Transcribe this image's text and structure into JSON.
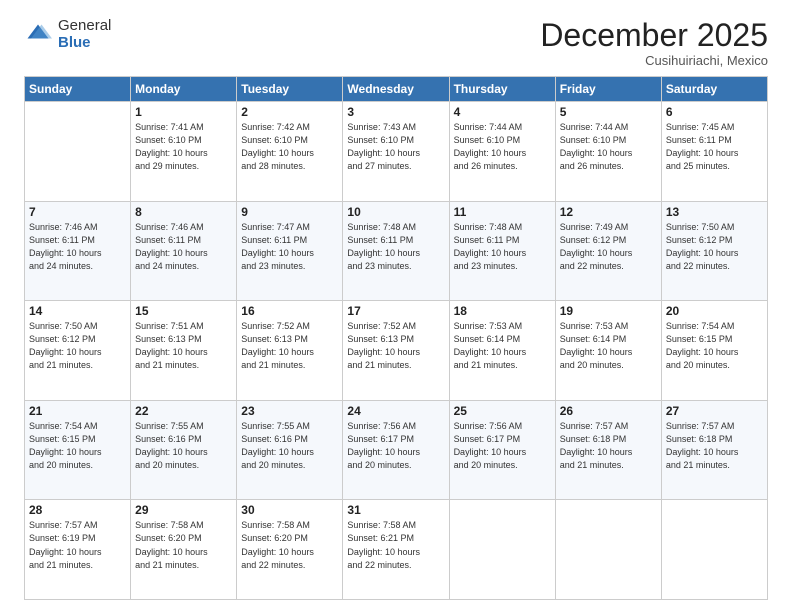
{
  "logo": {
    "general": "General",
    "blue": "Blue"
  },
  "header": {
    "month": "December 2025",
    "location": "Cusihuiriachi, Mexico"
  },
  "weekdays": [
    "Sunday",
    "Monday",
    "Tuesday",
    "Wednesday",
    "Thursday",
    "Friday",
    "Saturday"
  ],
  "weeks": [
    [
      {
        "day": "",
        "info": ""
      },
      {
        "day": "1",
        "info": "Sunrise: 7:41 AM\nSunset: 6:10 PM\nDaylight: 10 hours\nand 29 minutes."
      },
      {
        "day": "2",
        "info": "Sunrise: 7:42 AM\nSunset: 6:10 PM\nDaylight: 10 hours\nand 28 minutes."
      },
      {
        "day": "3",
        "info": "Sunrise: 7:43 AM\nSunset: 6:10 PM\nDaylight: 10 hours\nand 27 minutes."
      },
      {
        "day": "4",
        "info": "Sunrise: 7:44 AM\nSunset: 6:10 PM\nDaylight: 10 hours\nand 26 minutes."
      },
      {
        "day": "5",
        "info": "Sunrise: 7:44 AM\nSunset: 6:10 PM\nDaylight: 10 hours\nand 26 minutes."
      },
      {
        "day": "6",
        "info": "Sunrise: 7:45 AM\nSunset: 6:11 PM\nDaylight: 10 hours\nand 25 minutes."
      }
    ],
    [
      {
        "day": "7",
        "info": "Sunrise: 7:46 AM\nSunset: 6:11 PM\nDaylight: 10 hours\nand 24 minutes."
      },
      {
        "day": "8",
        "info": "Sunrise: 7:46 AM\nSunset: 6:11 PM\nDaylight: 10 hours\nand 24 minutes."
      },
      {
        "day": "9",
        "info": "Sunrise: 7:47 AM\nSunset: 6:11 PM\nDaylight: 10 hours\nand 23 minutes."
      },
      {
        "day": "10",
        "info": "Sunrise: 7:48 AM\nSunset: 6:11 PM\nDaylight: 10 hours\nand 23 minutes."
      },
      {
        "day": "11",
        "info": "Sunrise: 7:48 AM\nSunset: 6:11 PM\nDaylight: 10 hours\nand 23 minutes."
      },
      {
        "day": "12",
        "info": "Sunrise: 7:49 AM\nSunset: 6:12 PM\nDaylight: 10 hours\nand 22 minutes."
      },
      {
        "day": "13",
        "info": "Sunrise: 7:50 AM\nSunset: 6:12 PM\nDaylight: 10 hours\nand 22 minutes."
      }
    ],
    [
      {
        "day": "14",
        "info": "Sunrise: 7:50 AM\nSunset: 6:12 PM\nDaylight: 10 hours\nand 21 minutes."
      },
      {
        "day": "15",
        "info": "Sunrise: 7:51 AM\nSunset: 6:13 PM\nDaylight: 10 hours\nand 21 minutes."
      },
      {
        "day": "16",
        "info": "Sunrise: 7:52 AM\nSunset: 6:13 PM\nDaylight: 10 hours\nand 21 minutes."
      },
      {
        "day": "17",
        "info": "Sunrise: 7:52 AM\nSunset: 6:13 PM\nDaylight: 10 hours\nand 21 minutes."
      },
      {
        "day": "18",
        "info": "Sunrise: 7:53 AM\nSunset: 6:14 PM\nDaylight: 10 hours\nand 21 minutes."
      },
      {
        "day": "19",
        "info": "Sunrise: 7:53 AM\nSunset: 6:14 PM\nDaylight: 10 hours\nand 20 minutes."
      },
      {
        "day": "20",
        "info": "Sunrise: 7:54 AM\nSunset: 6:15 PM\nDaylight: 10 hours\nand 20 minutes."
      }
    ],
    [
      {
        "day": "21",
        "info": "Sunrise: 7:54 AM\nSunset: 6:15 PM\nDaylight: 10 hours\nand 20 minutes."
      },
      {
        "day": "22",
        "info": "Sunrise: 7:55 AM\nSunset: 6:16 PM\nDaylight: 10 hours\nand 20 minutes."
      },
      {
        "day": "23",
        "info": "Sunrise: 7:55 AM\nSunset: 6:16 PM\nDaylight: 10 hours\nand 20 minutes."
      },
      {
        "day": "24",
        "info": "Sunrise: 7:56 AM\nSunset: 6:17 PM\nDaylight: 10 hours\nand 20 minutes."
      },
      {
        "day": "25",
        "info": "Sunrise: 7:56 AM\nSunset: 6:17 PM\nDaylight: 10 hours\nand 20 minutes."
      },
      {
        "day": "26",
        "info": "Sunrise: 7:57 AM\nSunset: 6:18 PM\nDaylight: 10 hours\nand 21 minutes."
      },
      {
        "day": "27",
        "info": "Sunrise: 7:57 AM\nSunset: 6:18 PM\nDaylight: 10 hours\nand 21 minutes."
      }
    ],
    [
      {
        "day": "28",
        "info": "Sunrise: 7:57 AM\nSunset: 6:19 PM\nDaylight: 10 hours\nand 21 minutes."
      },
      {
        "day": "29",
        "info": "Sunrise: 7:58 AM\nSunset: 6:20 PM\nDaylight: 10 hours\nand 21 minutes."
      },
      {
        "day": "30",
        "info": "Sunrise: 7:58 AM\nSunset: 6:20 PM\nDaylight: 10 hours\nand 22 minutes."
      },
      {
        "day": "31",
        "info": "Sunrise: 7:58 AM\nSunset: 6:21 PM\nDaylight: 10 hours\nand 22 minutes."
      },
      {
        "day": "",
        "info": ""
      },
      {
        "day": "",
        "info": ""
      },
      {
        "day": "",
        "info": ""
      }
    ]
  ]
}
